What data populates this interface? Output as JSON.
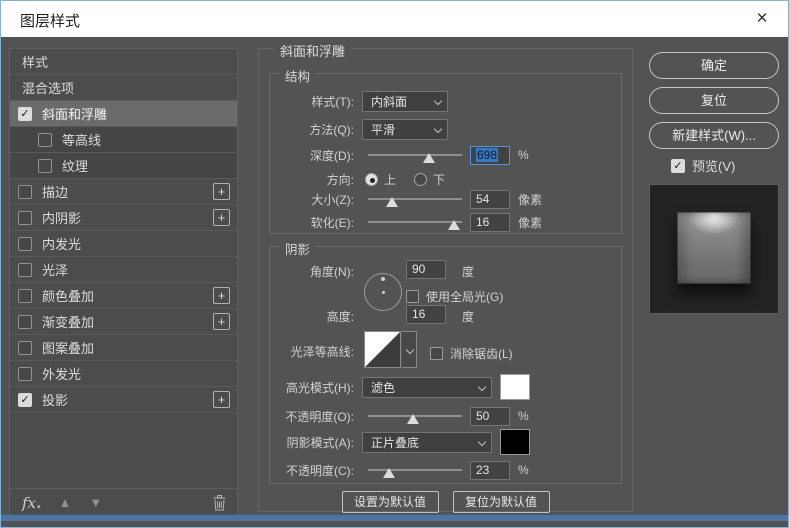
{
  "window": {
    "title": "图层样式",
    "close_label": "×"
  },
  "colors": {
    "accent_selection": "#3878bf",
    "selection_border": "#4f94e8",
    "highlight_swatch": "#ffffff",
    "shadow_swatch": "#000000",
    "bottom_strip": "#4d759d"
  },
  "sidebar": {
    "items": [
      {
        "label": "样式",
        "type": "plain",
        "checked": false,
        "selected": false,
        "sub": false,
        "plus": false
      },
      {
        "label": "混合选项",
        "type": "plain",
        "checked": false,
        "selected": false,
        "sub": false,
        "plus": false
      },
      {
        "label": "斜面和浮雕",
        "type": "check",
        "checked": true,
        "selected": true,
        "sub": false,
        "plus": false
      },
      {
        "label": "等高线",
        "type": "check",
        "checked": false,
        "selected": false,
        "sub": true,
        "plus": false
      },
      {
        "label": "纹理",
        "type": "check",
        "checked": false,
        "selected": false,
        "sub": true,
        "plus": false
      },
      {
        "label": "描边",
        "type": "check",
        "checked": false,
        "selected": false,
        "sub": false,
        "plus": true
      },
      {
        "label": "内阴影",
        "type": "check",
        "checked": false,
        "selected": false,
        "sub": false,
        "plus": true
      },
      {
        "label": "内发光",
        "type": "check",
        "checked": false,
        "selected": false,
        "sub": false,
        "plus": false
      },
      {
        "label": "光泽",
        "type": "check",
        "checked": false,
        "selected": false,
        "sub": false,
        "plus": false
      },
      {
        "label": "颜色叠加",
        "type": "check",
        "checked": false,
        "selected": false,
        "sub": false,
        "plus": true
      },
      {
        "label": "渐变叠加",
        "type": "check",
        "checked": false,
        "selected": false,
        "sub": false,
        "plus": true
      },
      {
        "label": "图案叠加",
        "type": "check",
        "checked": false,
        "selected": false,
        "sub": false,
        "plus": false
      },
      {
        "label": "外发光",
        "type": "check",
        "checked": false,
        "selected": false,
        "sub": false,
        "plus": false
      },
      {
        "label": "投影",
        "type": "check",
        "checked": true,
        "selected": false,
        "sub": false,
        "plus": true
      }
    ],
    "footer": {
      "fx_label": "fx",
      "plus_glyph": "+",
      "check_glyph": "✓",
      "up_arrow": "▲",
      "down_arrow": "▼"
    }
  },
  "panel": {
    "title": "斜面和浮雕",
    "structure": {
      "title": "结构",
      "style_label": "样式(T):",
      "style_value": "内斜面",
      "technique_label": "方法(Q):",
      "technique_value": "平滑",
      "depth_label": "深度(D):",
      "depth_value": "698",
      "depth_unit": "%",
      "direction_label": "方向:",
      "direction_up": "上",
      "direction_down": "下",
      "direction_selected": "up",
      "size_label": "大小(Z):",
      "size_value": "54",
      "size_unit": "像素",
      "soften_label": "软化(E):",
      "soften_value": "16",
      "soften_unit": "像素"
    },
    "shading": {
      "title": "阴影",
      "angle_label": "角度(N):",
      "angle_value": "90",
      "angle_unit": "度",
      "use_global_light_label": "使用全局光(G)",
      "use_global_light_checked": false,
      "altitude_label": "高度:",
      "altitude_value": "16",
      "altitude_unit": "度",
      "gloss_contour_label": "光泽等高线:",
      "anti_alias_label": "消除锯齿(L)",
      "anti_alias_checked": false,
      "highlight_mode_label": "高光模式(H):",
      "highlight_mode_value": "滤色",
      "highlight_opacity_label": "不透明度(O):",
      "highlight_opacity_value": "50",
      "highlight_opacity_unit": "%",
      "shadow_mode_label": "阴影模式(A):",
      "shadow_mode_value": "正片叠底",
      "shadow_opacity_label": "不透明度(C):",
      "shadow_opacity_value": "23",
      "shadow_opacity_unit": "%"
    },
    "footer_buttons": {
      "set_default": "设置为默认值",
      "reset_default": "复位为默认值"
    }
  },
  "actions": {
    "ok": "确定",
    "reset": "复位",
    "new_style": "新建样式(W)...",
    "preview_label": "预览(V)",
    "preview_checked": true
  },
  "sliders": {
    "depth_pct": 65,
    "size_pct": 25,
    "soften_pct": 92,
    "highlight_opacity_pct": 48,
    "shadow_opacity_pct": 22
  }
}
